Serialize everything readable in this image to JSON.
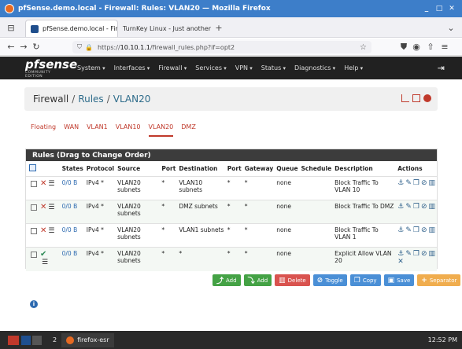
{
  "window": {
    "title": "pfSense.demo.local - Firewall: Rules: VLAN20 — Mozilla Firefox"
  },
  "browser": {
    "tabs": [
      {
        "label": "pfSense.demo.local - Fire"
      },
      {
        "label": "TurnKey Linux - Just another"
      }
    ],
    "url": {
      "host": "10.10.1.1",
      "rest": "/firewall_rules.php?if=opt2",
      "prefix": "https://"
    }
  },
  "app": {
    "logo": "sense",
    "logo_prefix": "pf",
    "logo_sub": "COMMUNITY EDITION",
    "menu": [
      "System",
      "Interfaces",
      "Firewall",
      "Services",
      "VPN",
      "Status",
      "Diagnostics",
      "Help"
    ]
  },
  "breadcrumb": {
    "part1": "Firewall",
    "part2": "Rules",
    "part3": "VLAN20",
    "sep": "/"
  },
  "iface_tabs": [
    "Floating",
    "WAN",
    "VLAN1",
    "VLAN10",
    "VLAN20",
    "DMZ"
  ],
  "panel": {
    "title": "Rules (Drag to Change Order)",
    "columns": [
      "States",
      "Protocol",
      "Source",
      "Port",
      "Destination",
      "Port",
      "Gateway",
      "Queue",
      "Schedule",
      "Description",
      "Actions"
    ],
    "rows": [
      {
        "states": "0/0 B",
        "protocol": "IPv4 *",
        "source": "VLAN20 subnets",
        "sport": "*",
        "dest": "VLAN10 subnets",
        "dport": "*",
        "gateway": "*",
        "queue": "none",
        "schedule": "",
        "desc": "Block Traffic To VLAN 10",
        "action": "block"
      },
      {
        "states": "0/0 B",
        "protocol": "IPv4 *",
        "source": "VLAN20 subnets",
        "sport": "*",
        "dest": "DMZ subnets",
        "dport": "*",
        "gateway": "*",
        "queue": "none",
        "schedule": "",
        "desc": "Block Traffic To DMZ",
        "action": "block"
      },
      {
        "states": "0/0 B",
        "protocol": "IPv4 *",
        "source": "VLAN20 subnets",
        "sport": "*",
        "dest": "VLAN1 subnets",
        "dport": "*",
        "gateway": "*",
        "queue": "none",
        "schedule": "",
        "desc": "Block Traffic To VLAN 1",
        "action": "block"
      },
      {
        "states": "0/0 B",
        "protocol": "IPv4 *",
        "source": "VLAN20 subnets",
        "sport": "*",
        "dest": "*",
        "dport": "*",
        "gateway": "*",
        "queue": "none",
        "schedule": "",
        "desc": "Explicit Allow VLAN 20",
        "action": "pass"
      }
    ]
  },
  "buttons": {
    "add_top": "Add",
    "add_bottom": "Add",
    "delete": "Delete",
    "toggle": "Toggle",
    "copy": "Copy",
    "save": "Save",
    "separator": "Separator"
  },
  "taskbar": {
    "workspace": "2",
    "app": "firefox-esr",
    "time": "12:52 PM"
  }
}
